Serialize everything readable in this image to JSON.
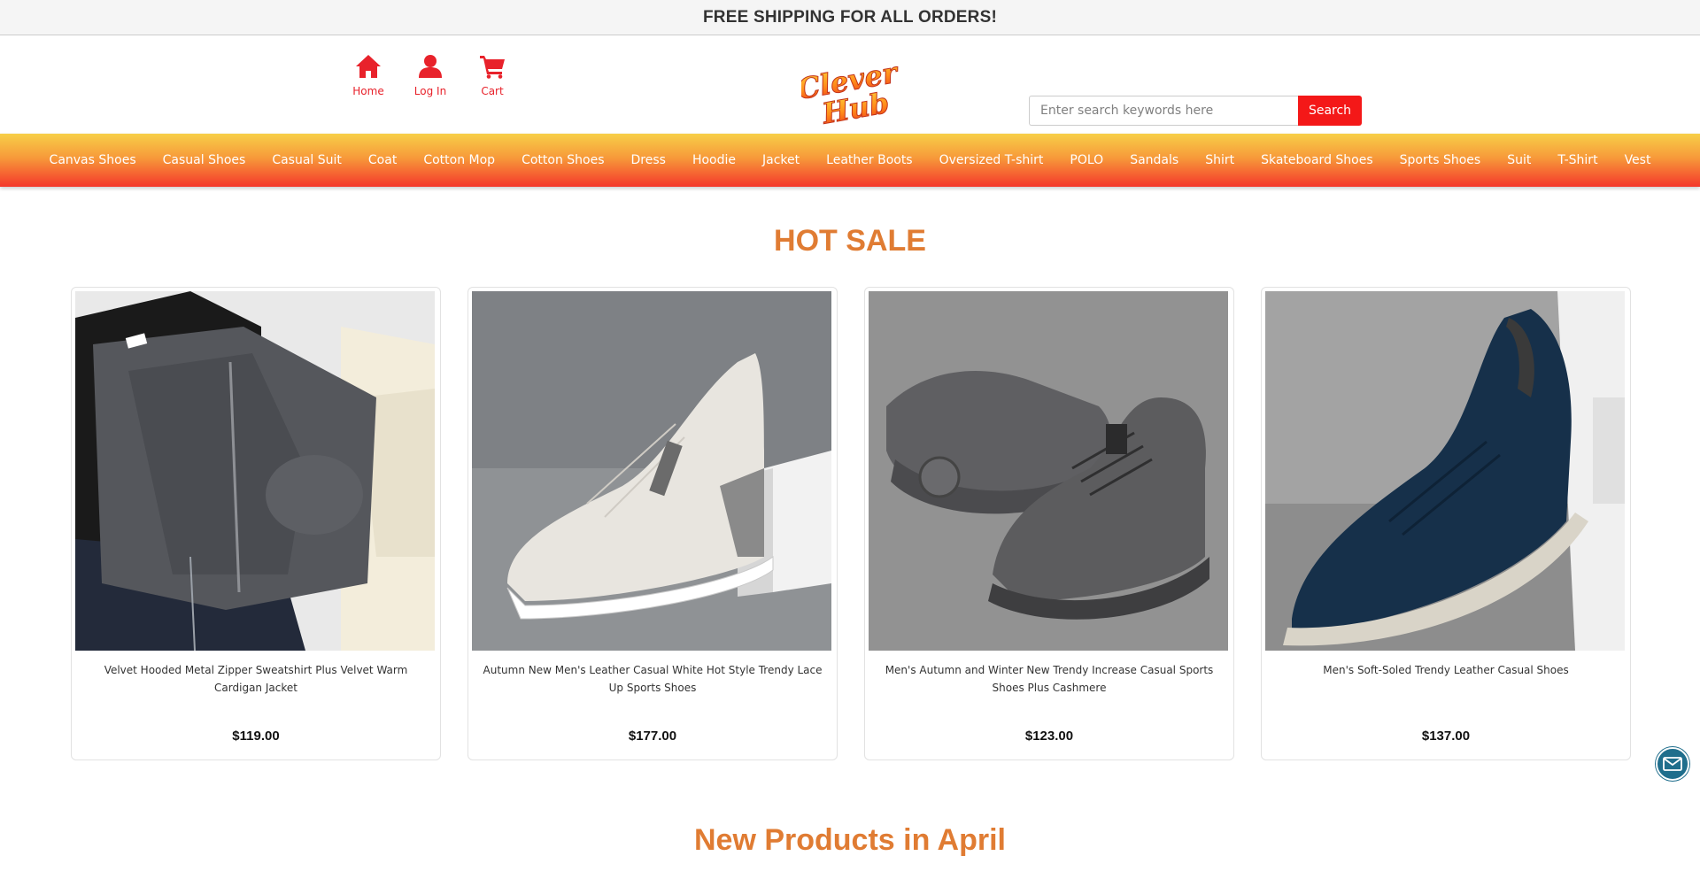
{
  "announcement": "FREE SHIPPING FOR ALL ORDERS!",
  "nav": {
    "home": "Home",
    "login": "Log In",
    "cart": "Cart"
  },
  "logo": {
    "line1": "Clever",
    "line2": "Hub"
  },
  "search": {
    "placeholder": "Enter search keywords here",
    "button": "Search"
  },
  "categories": [
    "Canvas Shoes",
    "Casual Shoes",
    "Casual Suit",
    "Coat",
    "Cotton Mop",
    "Cotton Shoes",
    "Dress",
    "Hoodie",
    "Jacket",
    "Leather Boots",
    "Oversized T-shirt",
    "POLO",
    "Sandals",
    "Shirt",
    "Skateboard Shoes",
    "Sports Shoes",
    "Suit",
    "T-Shirt",
    "Vest"
  ],
  "hot_sale": {
    "title": "HOT SALE",
    "products": [
      {
        "title": "Velvet Hooded Metal Zipper Sweatshirt Plus Velvet Warm Cardigan Jacket",
        "price": "$119.00"
      },
      {
        "title": "Autumn New Men's Leather Casual White Hot Style Trendy Lace Up Sports Shoes",
        "price": "$177.00"
      },
      {
        "title": "Men's Autumn and Winter New Trendy Increase Casual Sports Shoes Plus Cashmere",
        "price": "$123.00"
      },
      {
        "title": "Men's Soft-Soled Trendy Leather Casual Shoes",
        "price": "$137.00"
      }
    ]
  },
  "new_products": {
    "title": "New Products in April"
  },
  "colors": {
    "accent": "#f41818",
    "title_orange": "#e07c33",
    "mail_button": "#1f6e8c"
  }
}
